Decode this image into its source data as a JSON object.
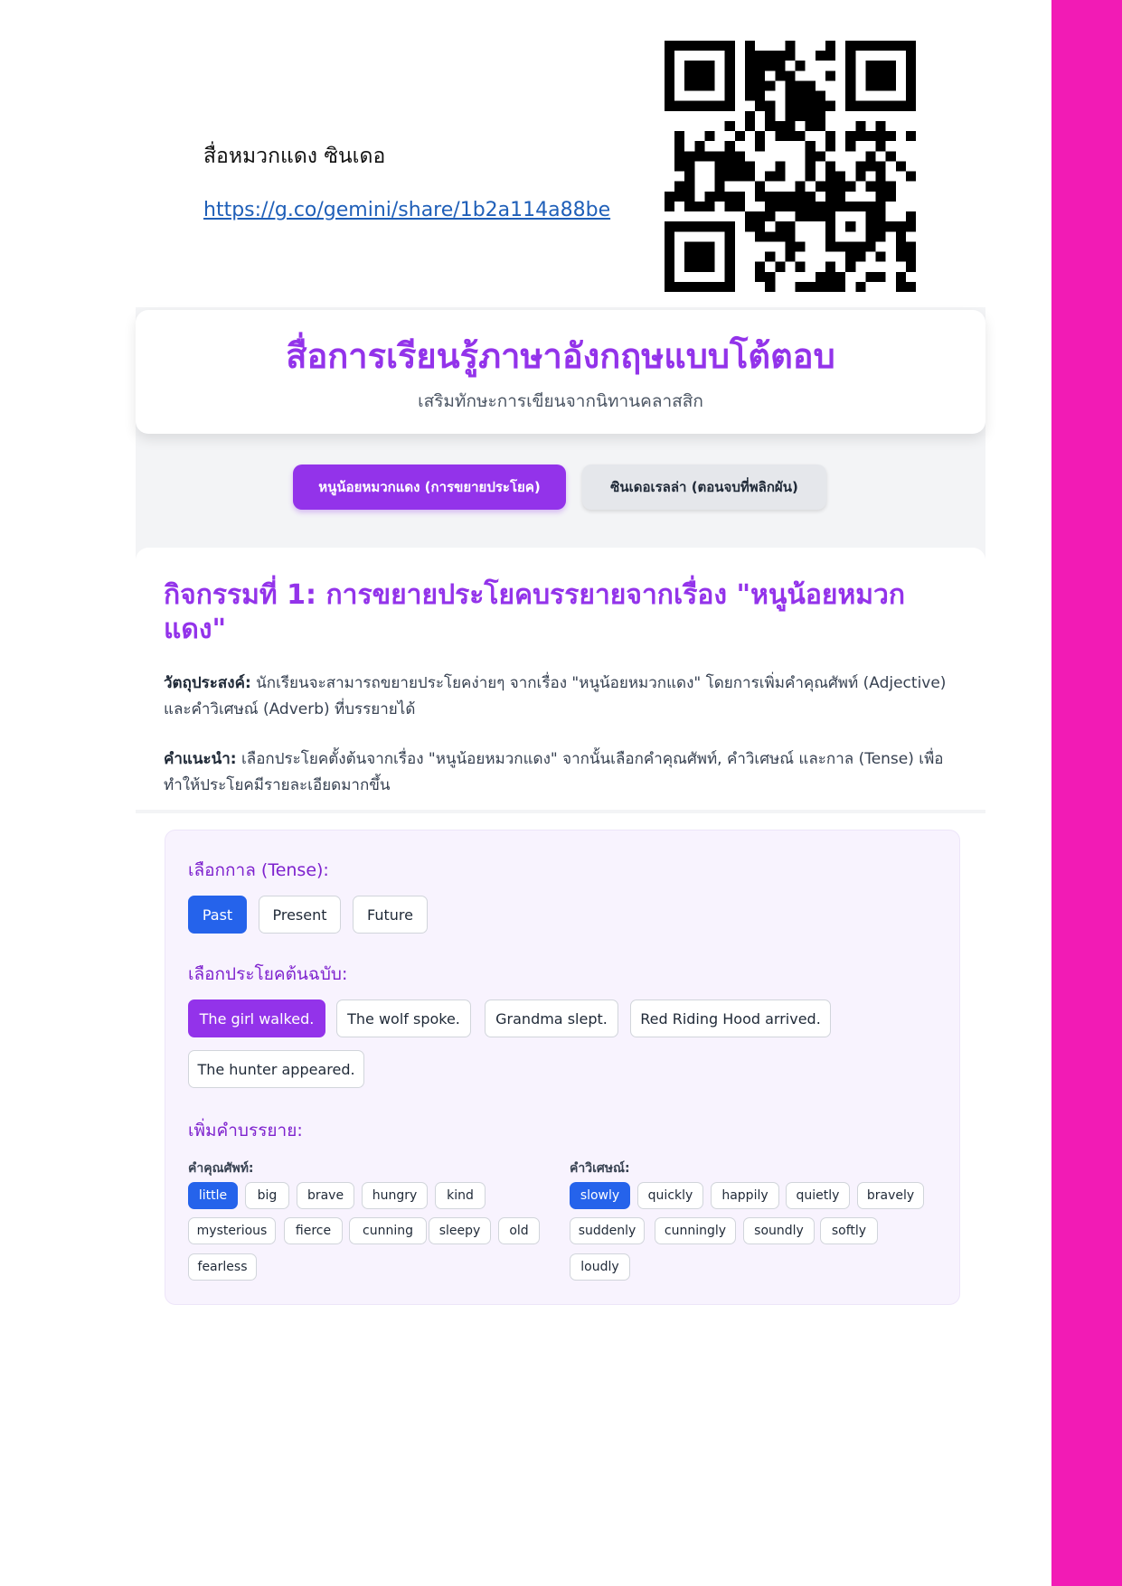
{
  "header": {
    "doc_title": "สื่อหมวกแดง ซินเดอ",
    "share_link": "https://g.co/gemini/share/1b2a114a88be",
    "qr_code_icon": "qr-code"
  },
  "hero": {
    "title": "สื่อการเรียนรู้ภาษาอังกฤษแบบโต้ตอบ",
    "subtitle": "เสริมทักษะการเขียนจากนิทานคลาสสิก"
  },
  "tabs": [
    {
      "label": "หนูน้อยหมวกแดง (การขยายประโยค)",
      "active": true
    },
    {
      "label": "ซินเดอเรลล่า (ตอนจบที่พลิกผัน)",
      "active": false
    }
  ],
  "activity": {
    "title": "กิจกรรมที่ 1: การขยายประโยคบรรยายจากเรื่อง \"หนูน้อยหมวกแดง\"",
    "objective_label": "วัตถุประสงค์:",
    "objective_text": " นักเรียนจะสามารถขยายประโยคง่ายๆ จากเรื่อง \"หนูน้อยหมวกแดง\" โดยการเพิ่มคำคุณศัพท์ (Adjective) และคำวิเศษณ์ (Adverb) ที่บรรยายได้",
    "instruction_label": "คำแนะนำ:",
    "instruction_text": " เลือกประโยคตั้งต้นจากเรื่อง \"หนูน้อยหมวกแดง\" จากนั้นเลือกคำคุณศัพท์, คำวิเศษณ์ และกาล (Tense) เพื่อทำให้ประโยคมีรายละเอียดมากขึ้น"
  },
  "panel": {
    "tense_label": "เลือกกาล (Tense):",
    "tenses": [
      "Past",
      "Present",
      "Future"
    ],
    "selected_tense": "Past",
    "sentence_label": "เลือกประโยคต้นฉบับ:",
    "sentences": [
      "The girl walked.",
      "The wolf spoke.",
      "Grandma slept.",
      "Red Riding Hood arrived.",
      "The hunter appeared."
    ],
    "selected_sentence": "The girl walked.",
    "describe_label": "เพิ่มคำบรรยาย:",
    "adjective_label": "คำคุณศัพท์:",
    "adjectives": [
      "little",
      "big",
      "brave",
      "hungry",
      "kind",
      "mysterious",
      "fierce",
      "cunning",
      "sleepy",
      "old",
      "fearless"
    ],
    "selected_adjective": "little",
    "adverb_label": "คำวิเศษณ์:",
    "adverbs": [
      "slowly",
      "quickly",
      "happily",
      "quietly",
      "bravely",
      "suddenly",
      "cunningly",
      "soundly",
      "softly",
      "loudly"
    ],
    "selected_adverb": "slowly"
  },
  "colors": {
    "accent_purple": "#9333ea",
    "selected_blue": "#2563eb",
    "side_bar_pink": "#f21bb5",
    "link_blue": "#1f5fb8"
  }
}
